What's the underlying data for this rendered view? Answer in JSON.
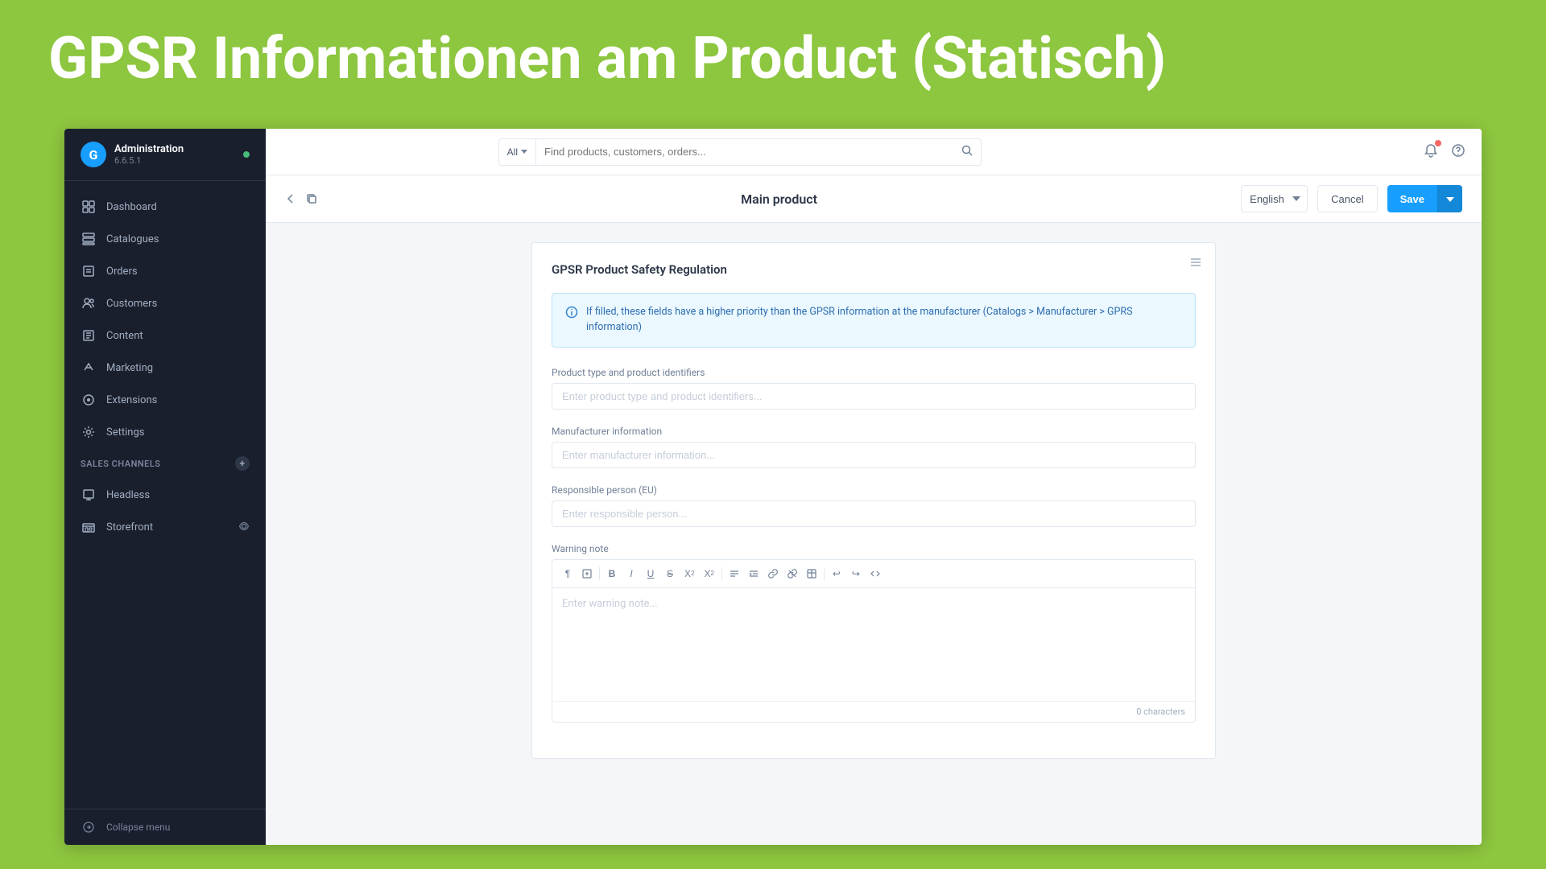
{
  "overlay": {
    "title": "GPSR Informationen am Product (Statisch)"
  },
  "sidebar": {
    "app_name": "Administration",
    "version": "6.6.5.1",
    "nav_items": [
      {
        "id": "dashboard",
        "label": "Dashboard",
        "icon": "⊙"
      },
      {
        "id": "catalogues",
        "label": "Catalogues",
        "icon": "☰"
      },
      {
        "id": "orders",
        "label": "Orders",
        "icon": "□"
      },
      {
        "id": "customers",
        "label": "Customers",
        "icon": "👥"
      },
      {
        "id": "content",
        "label": "Content",
        "icon": "◫"
      },
      {
        "id": "marketing",
        "label": "Marketing",
        "icon": "◈"
      },
      {
        "id": "extensions",
        "label": "Extensions",
        "icon": "✦"
      },
      {
        "id": "settings",
        "label": "Settings",
        "icon": "⚙"
      }
    ],
    "sales_channels_label": "Sales Channels",
    "sales_channel_items": [
      {
        "id": "headless",
        "label": "Headless",
        "icon": "□"
      },
      {
        "id": "storefront",
        "label": "Storefront",
        "icon": "⊞"
      }
    ],
    "collapse_label": "Collapse menu"
  },
  "topbar": {
    "search_scope": "All",
    "search_placeholder": "Find products, customers, orders..."
  },
  "product_toolbar": {
    "title": "Main product",
    "language": "English",
    "cancel_label": "Cancel",
    "save_label": "Save"
  },
  "form": {
    "card_title": "GPSR Product Safety Regulation",
    "info_text": "If filled, these fields have a higher priority than the GPSR information at the manufacturer (Catalogs > Manufacturer > GPRS information)",
    "product_type_label": "Product type and product identifiers",
    "product_type_placeholder": "Enter product type and product identifiers...",
    "manufacturer_label": "Manufacturer information",
    "manufacturer_placeholder": "Enter manufacturer information...",
    "responsible_label": "Responsible person (EU)",
    "responsible_placeholder": "Enter responsible person...",
    "warning_label": "Warning note",
    "warning_placeholder": "Enter warning note...",
    "char_count": "0 characters"
  }
}
